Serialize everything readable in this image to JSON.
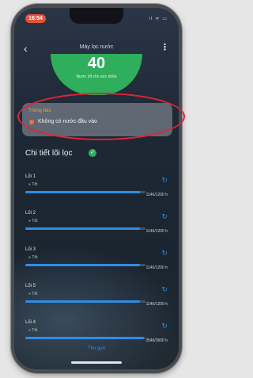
{
  "status_bar": {
    "time": "16:54",
    "icons": "ıl ᯤ ▭"
  },
  "nav": {
    "title": "Máy lọc nước"
  },
  "water_status": {
    "tds_value": "40",
    "caption": "Nước tốt cho sức khỏe"
  },
  "notification": {
    "title": "Thông báo",
    "message": "Không có nước đầu vào"
  },
  "filters_section": {
    "title": "Chi tiết lõi lọc"
  },
  "filters": [
    {
      "name": "Lõi 1",
      "status": "Tốt",
      "used": 1146,
      "capacity": 1200,
      "count_text": "1146/1200 h"
    },
    {
      "name": "Lõi 2",
      "status": "Tốt",
      "used": 1146,
      "capacity": 1200,
      "count_text": "1146/1200 h"
    },
    {
      "name": "Lõi 3",
      "status": "Tốt",
      "used": 1146,
      "capacity": 1200,
      "count_text": "1146/1200 h"
    },
    {
      "name": "Lõi 5",
      "status": "Tốt",
      "used": 1146,
      "capacity": 1200,
      "count_text": "1146/1200 h"
    },
    {
      "name": "Lõi 4",
      "status": "Tốt",
      "used": 3546,
      "capacity": 3600,
      "count_text": "3546/3600 h"
    }
  ],
  "collapse_label": "Thu gọn",
  "colors": {
    "accent": "#2e8de6",
    "good": "#2fae5c",
    "warning": "#f39a3d",
    "highlight": "#e0243a"
  }
}
